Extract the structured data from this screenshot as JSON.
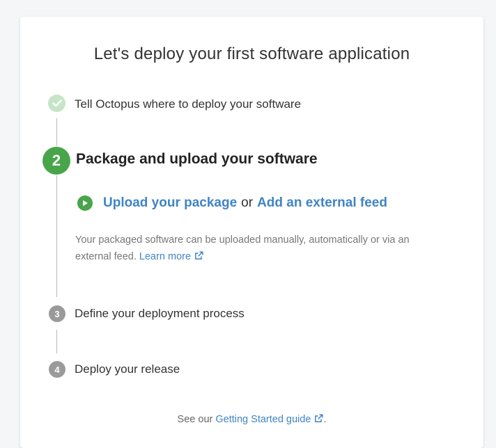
{
  "page": {
    "title": "Let's deploy your first software application"
  },
  "steps": [
    {
      "number": "",
      "label": "Tell Octopus where to deploy your software",
      "status": "complete"
    },
    {
      "number": "2",
      "label": "Package and upload your software",
      "status": "active"
    },
    {
      "number": "3",
      "label": "Define your deployment process",
      "status": "pending"
    },
    {
      "number": "4",
      "label": "Deploy your release",
      "status": "pending"
    }
  ],
  "active_step": {
    "upload_link": "Upload your package",
    "or_text": "or",
    "feed_link": "Add an external feed",
    "description": "Your packaged software can be uploaded manually, automatically or via an external feed.",
    "learn_more": "Learn more"
  },
  "footer": {
    "prefix": "See our",
    "link": "Getting Started guide",
    "suffix": "."
  },
  "colors": {
    "accent_green": "#48a54a",
    "completed_green": "#c6e4c6",
    "link_blue": "#3f84c5",
    "pending_gray": "#9a9a9a"
  },
  "icons": {
    "complete": "check-icon",
    "action": "play-icon",
    "external": "external-link-icon"
  }
}
